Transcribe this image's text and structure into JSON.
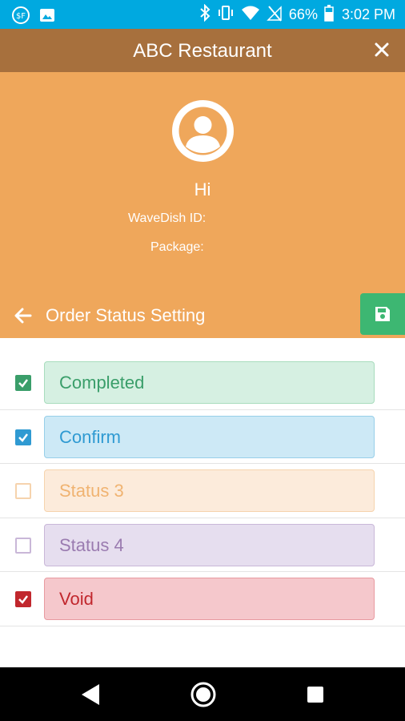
{
  "status_bar": {
    "battery": "66%",
    "time": "3:02 PM"
  },
  "header": {
    "title": "ABC Restaurant"
  },
  "profile": {
    "greeting": "Hi",
    "wavedish_id_label": "WaveDish ID:",
    "package_label": "Package:"
  },
  "settings": {
    "title": "Order Status Setting"
  },
  "statuses": [
    {
      "label": "Completed",
      "checked": true,
      "color": "#3a9e6a",
      "fill": "#d6f0e2",
      "border": "#a8dcbd"
    },
    {
      "label": "Confirm",
      "checked": true,
      "color": "#2f9ad2",
      "fill": "#cde9f6",
      "border": "#97cfe9"
    },
    {
      "label": "Status 3",
      "checked": false,
      "color": "#f0b371",
      "fill": "#fcebdb",
      "border": "#f6d3ad"
    },
    {
      "label": "Status 4",
      "checked": false,
      "color": "#9a7bb0",
      "fill": "#e6deef",
      "border": "#c9b7d8"
    },
    {
      "label": "Void",
      "checked": true,
      "color": "#c1272d",
      "fill": "#f5c8cc",
      "border": "#e89aa0"
    }
  ],
  "colors": {
    "status_bar": "#00a9e0",
    "title_bar": "#a7703d",
    "profile_bg": "#efa75b",
    "save_button": "#3db772"
  }
}
